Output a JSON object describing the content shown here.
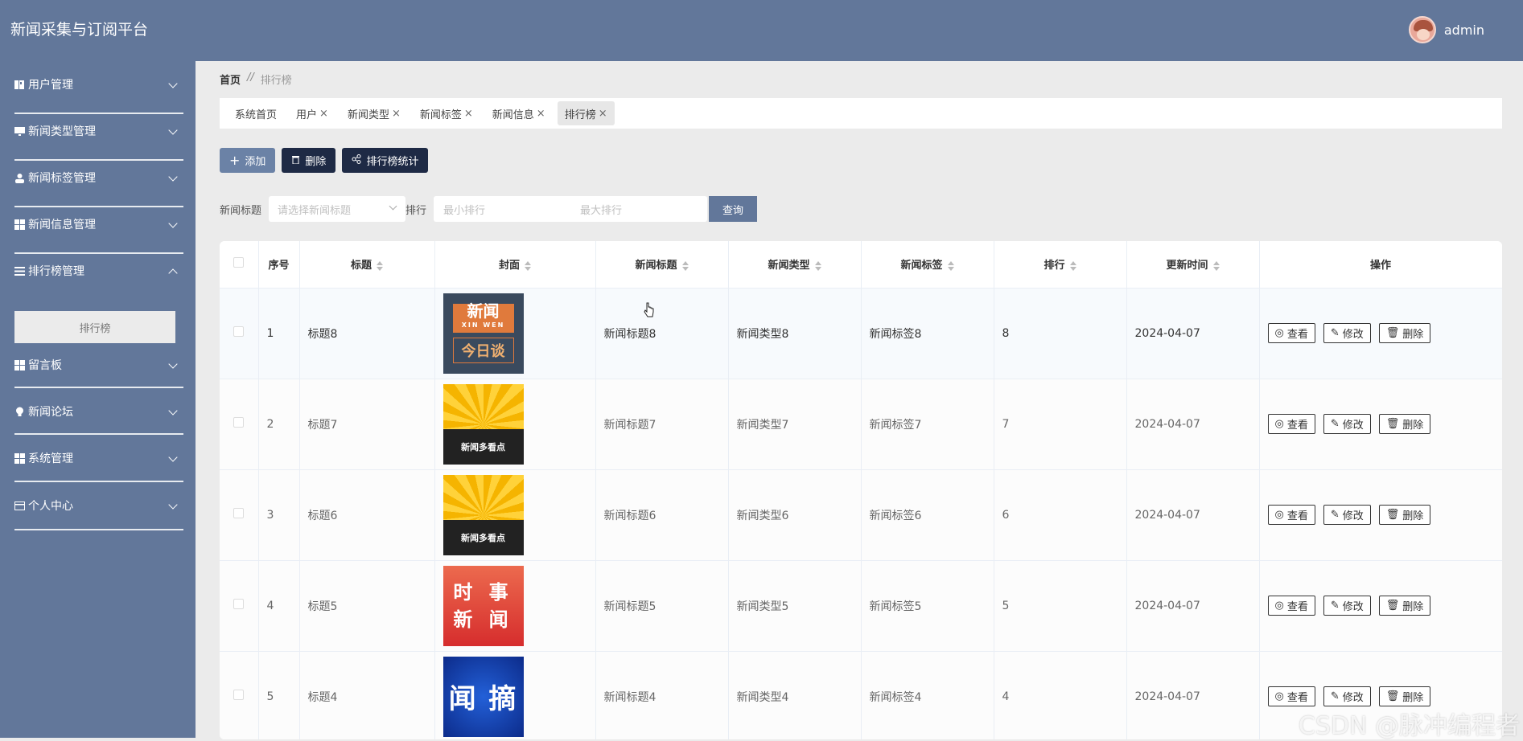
{
  "app": {
    "title": "新闻采集与订阅平台",
    "username": "admin"
  },
  "sidebar": {
    "items": [
      {
        "label": "用户管理",
        "icon": "user-book-icon"
      },
      {
        "label": "新闻类型管理",
        "icon": "monitor-icon"
      },
      {
        "label": "新闻标签管理",
        "icon": "person-icon"
      },
      {
        "label": "新闻信息管理",
        "icon": "grid-icon"
      },
      {
        "label": "排行榜管理",
        "icon": "list-icon",
        "expanded": true
      },
      {
        "label": "留言板",
        "icon": "grid-icon"
      },
      {
        "label": "新闻论坛",
        "icon": "bulb-icon"
      },
      {
        "label": "系统管理",
        "icon": "grid-icon"
      },
      {
        "label": "个人中心",
        "icon": "card-icon"
      }
    ],
    "submenu": {
      "label": "排行榜"
    }
  },
  "breadcrumb": {
    "home": "首页",
    "separator": "//",
    "current": "排行榜"
  },
  "tabs": [
    {
      "label": "系统首页",
      "closable": false
    },
    {
      "label": "用户",
      "closable": true
    },
    {
      "label": "新闻类型",
      "closable": true
    },
    {
      "label": "新闻标签",
      "closable": true
    },
    {
      "label": "新闻信息",
      "closable": true
    },
    {
      "label": "排行榜",
      "closable": true,
      "active": true
    }
  ],
  "toolbar": {
    "add": "添加",
    "delete": "删除",
    "stats": "排行榜统计"
  },
  "search": {
    "title_label": "新闻标题",
    "title_placeholder": "请选择新闻标题",
    "rank_label": "排行",
    "min_placeholder": "最小排行",
    "max_placeholder": "最大排行",
    "query_button": "查询"
  },
  "table": {
    "headers": [
      "序号",
      "标题",
      "封面",
      "新闻标题",
      "新闻类型",
      "新闻标签",
      "排行",
      "更新时间",
      "操作"
    ],
    "rows": [
      {
        "index": "1",
        "title": "标题8",
        "cover": "cover-1",
        "news_title": "新闻标题8",
        "news_type": "新闻类型8",
        "news_tag": "新闻标签8",
        "rank": "8",
        "updated": "2024-04-07"
      },
      {
        "index": "2",
        "title": "标题7",
        "cover": "cover-2",
        "news_title": "新闻标题7",
        "news_type": "新闻类型7",
        "news_tag": "新闻标签7",
        "rank": "7",
        "updated": "2024-04-07"
      },
      {
        "index": "3",
        "title": "标题6",
        "cover": "cover-2",
        "news_title": "新闻标题6",
        "news_type": "新闻类型6",
        "news_tag": "新闻标签6",
        "rank": "6",
        "updated": "2024-04-07"
      },
      {
        "index": "4",
        "title": "标题5",
        "cover": "cover-3",
        "news_title": "新闻标题5",
        "news_type": "新闻类型5",
        "news_tag": "新闻标签5",
        "rank": "5",
        "updated": "2024-04-07"
      },
      {
        "index": "5",
        "title": "标题4",
        "cover": "cover-4",
        "news_title": "新闻标题4",
        "news_type": "新闻类型4",
        "news_tag": "新闻标签4",
        "rank": "4",
        "updated": "2024-04-07"
      }
    ],
    "actions": {
      "view": "查看",
      "edit": "修改",
      "delete": "删除"
    }
  },
  "covers": {
    "cover-1": {
      "line1": "新闻",
      "line1_small": "XIN WEN",
      "line2": "今日谈"
    },
    "cover-2": {
      "band": "新闻多看点"
    },
    "cover-3": {
      "line1": "时 事",
      "line2": "新 闻"
    },
    "cover-4": {
      "text": "闻 摘"
    }
  },
  "watermark": "CSDN @脉冲编程者"
}
